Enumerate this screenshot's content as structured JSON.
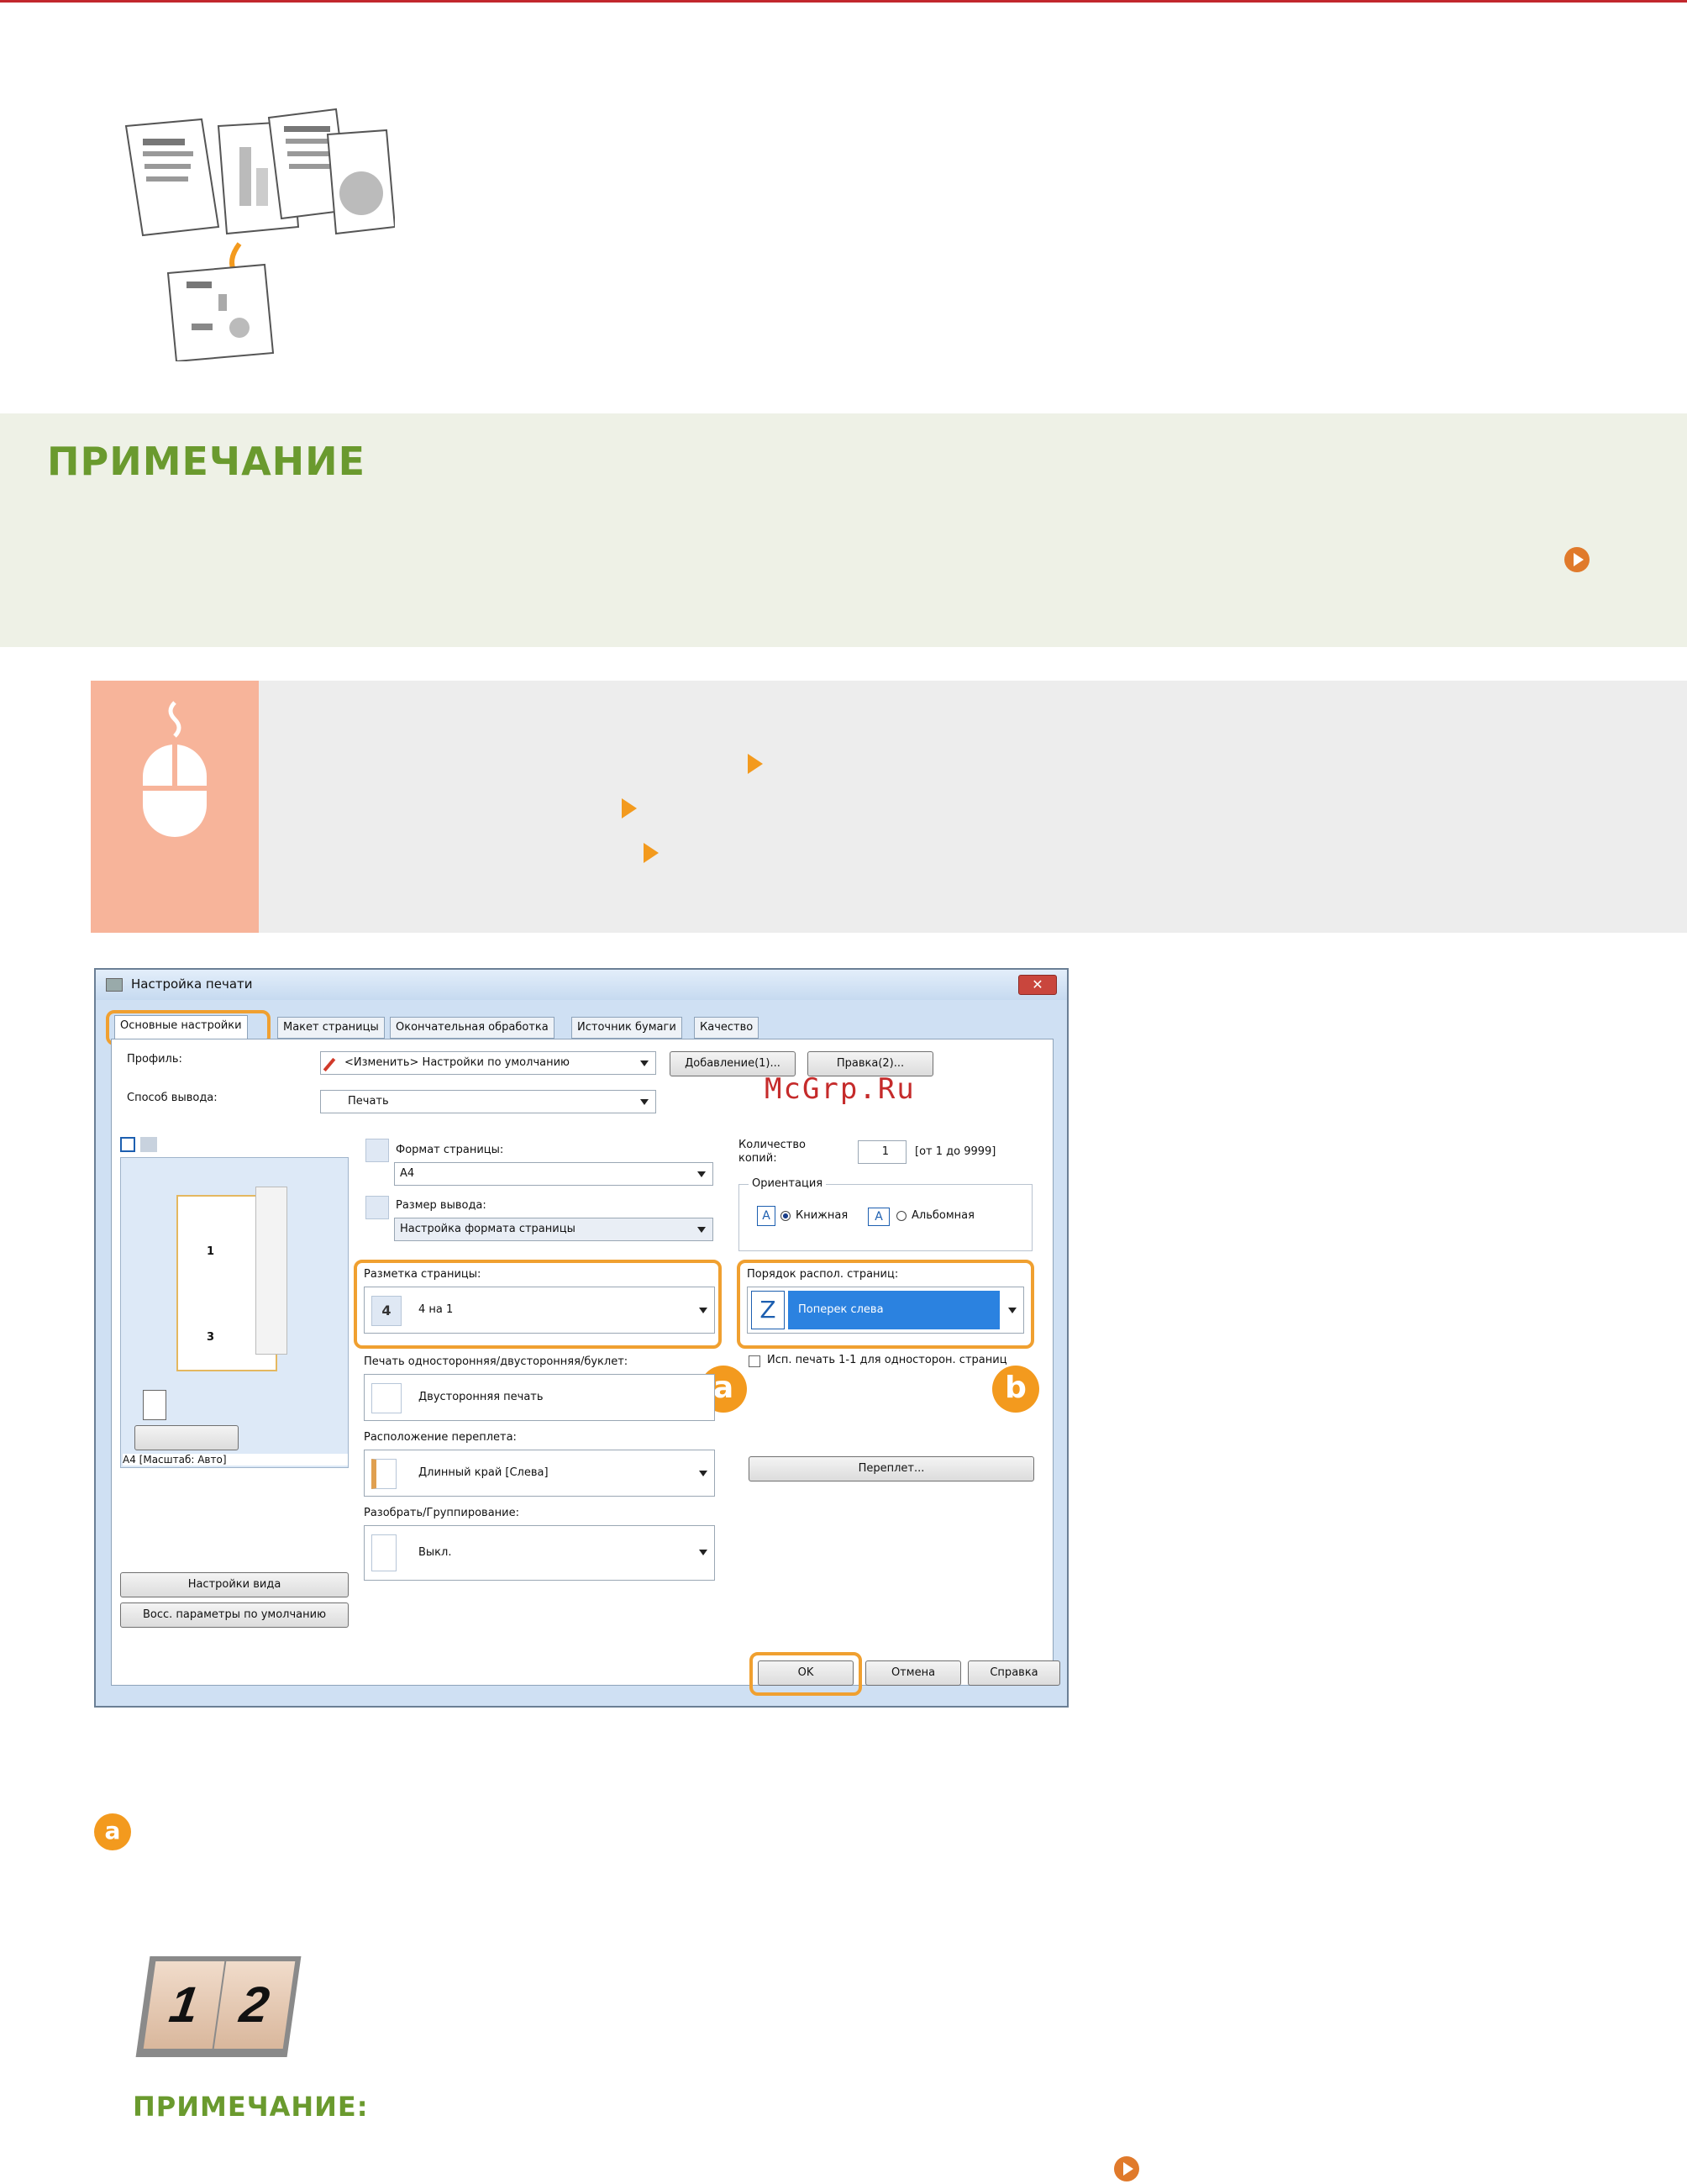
{
  "note": {
    "title": "ПРИМЕЧАНИЕ"
  },
  "watermark": "McGrp.Ru",
  "dialog": {
    "title": "Настройка печати",
    "close": "✕",
    "tabs": [
      "Основные настройки",
      "Макет страницы",
      "Окончательная обработка",
      "Источник бумаги",
      "Качество"
    ],
    "profile_label": "Профиль:",
    "profile_value": "<Изменить> Настройки по умолчанию",
    "add_button": "Добавление(1)...",
    "edit_button": "Правка(2)...",
    "output_method_label": "Способ вывода:",
    "output_method_value": "Печать",
    "page_size_label": "Формат страницы:",
    "page_size_value": "A4",
    "output_size_label": "Размер вывода:",
    "output_size_value": "Настройка формата страницы",
    "copies_label": "Количество копий:",
    "copies_value": "1",
    "copies_range": "[от 1 до 9999]",
    "orientation_label": "Ориентация",
    "orientation_portrait": "Книжная",
    "orientation_landscape": "Альбомная",
    "page_layout_label": "Разметка страницы:",
    "page_layout_icon": "4",
    "page_layout_value": "4 на 1",
    "page_order_label": "Порядок распол. страниц:",
    "page_order_value": "Поперек слева",
    "duplex_label": "Печать односторонняя/двусторонняя/буклет:",
    "duplex_value": "Двусторонняя печать",
    "oneside_checkbox": "Исп. печать 1-1 для односторон. страниц",
    "binding_label": "Расположение переплета:",
    "binding_value": "Длинный край [Слева]",
    "binding_button": "Переплет...",
    "collate_label": "Разобрать/Группирование:",
    "collate_value": "Выкл.",
    "preview_caption": "A4 [Масштаб: Авто]",
    "preview_page1": "1",
    "preview_page3": "3",
    "view_settings_button": "Настройки вида",
    "restore_button": "Восс. параметры по умолчанию",
    "ok_button": "OK",
    "cancel_button": "Отмена",
    "help_button": "Справка",
    "badge_a": "a",
    "badge_b": "b"
  },
  "section_a": {
    "bullet": "a"
  },
  "sample": {
    "page1": "1",
    "page2": "2"
  },
  "note2": {
    "title": "ПРИМЕЧАНИЕ:"
  }
}
